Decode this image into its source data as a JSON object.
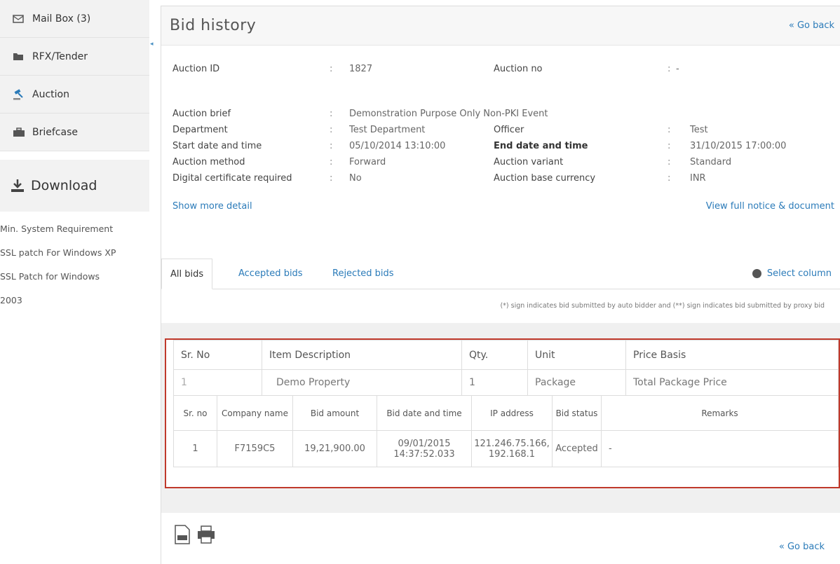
{
  "sidebar": {
    "items": [
      {
        "label": "Mail Box (3)",
        "icon": "mailbox-icon"
      },
      {
        "label": "RFX/Tender",
        "icon": "folder-icon"
      },
      {
        "label": "Auction",
        "icon": "auction-icon"
      },
      {
        "label": "Briefcase",
        "icon": "briefcase-icon"
      }
    ],
    "download_title": "Download",
    "download_links": [
      "Min. System Requirement",
      "SSL patch For Windows XP",
      "SSL Patch for Windows",
      "2003"
    ]
  },
  "header": {
    "title": "Bid history",
    "go_back": "« Go back"
  },
  "details": {
    "auction_id_label": "Auction ID",
    "auction_id": "1827",
    "auction_no_label": "Auction no",
    "auction_no": "-",
    "auction_brief_label": "Auction brief",
    "auction_brief": "Demonstration Purpose Only   Non-PKI Event",
    "department_label": "Department",
    "department": "Test Department",
    "officer_label": "Officer",
    "officer": "Test",
    "start_label": "Start date and time",
    "start": "05/10/2014 13:10:00",
    "end_label": "End date and time",
    "end": "31/10/2015 17:00:00",
    "method_label": "Auction method",
    "method": "Forward",
    "variant_label": "Auction variant",
    "variant": "Standard",
    "cert_label": "Digital certificate required",
    "cert": "No",
    "currency_label": "Auction base currency",
    "currency": "INR",
    "colon": ":",
    "show_more": "Show more detail",
    "view_notice": "View full notice & document"
  },
  "tabs": {
    "all": "All bids",
    "accepted": "Accepted bids",
    "rejected": "Rejected bids",
    "select_column": "Select column"
  },
  "note": "(*) sign indicates bid submitted by auto bidder and (**) sign indicates bid submitted by proxy bid",
  "item_table": {
    "headers": [
      "Sr. No",
      "Item Description",
      "Qty.",
      "Unit",
      "Price Basis"
    ],
    "row": [
      "1",
      "Demo Property",
      "1",
      "Package",
      "Total Package Price"
    ]
  },
  "bid_table": {
    "headers": [
      "Sr. no",
      "Company name",
      "Bid amount",
      "Bid date and time",
      "IP address",
      "Bid status",
      "Remarks"
    ],
    "row": [
      "1",
      "F7159C5",
      "19,21,900.00",
      "09/01/2015 14:37:52.033",
      "121.246.75.166, 192.168.1",
      "Accepted",
      "-"
    ]
  },
  "footer": {
    "go_back": "« Go back"
  }
}
